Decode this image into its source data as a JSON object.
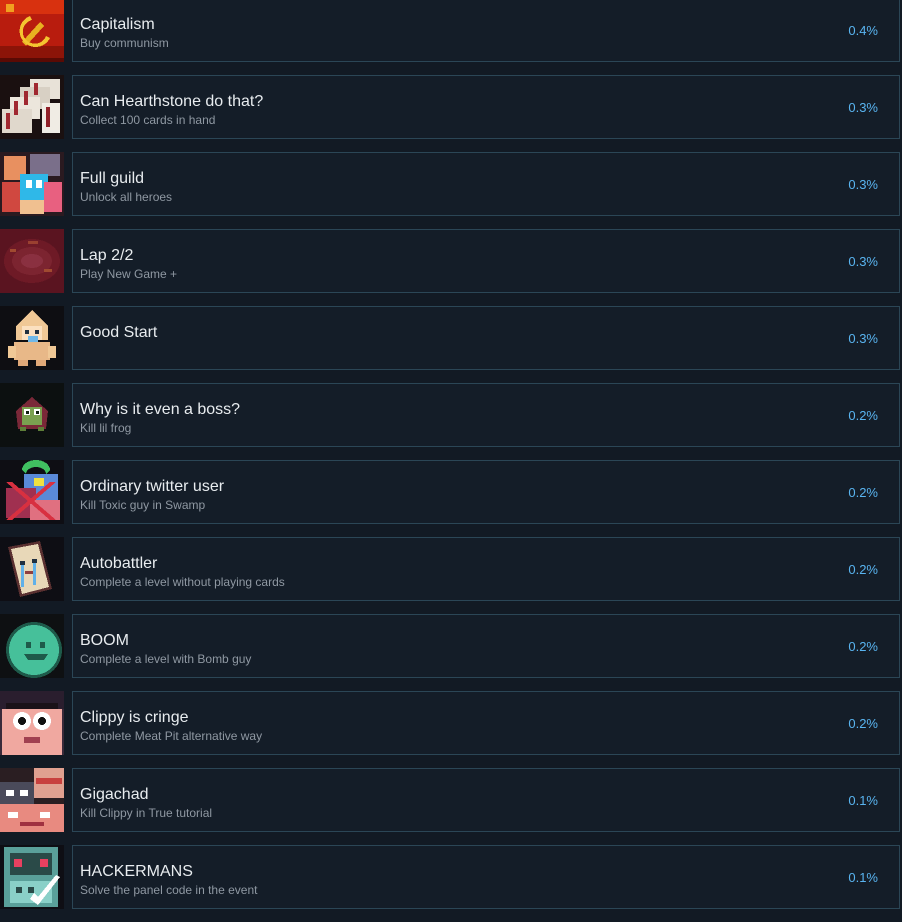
{
  "achievements": [
    {
      "title": "Capitalism",
      "desc": "Buy communism",
      "pct": "0.4%",
      "icon": "hammer-sickle-flag-icon"
    },
    {
      "title": "Can Hearthstone do that?",
      "desc": "Collect 100 cards in hand",
      "pct": "0.3%",
      "icon": "card-stack-icon"
    },
    {
      "title": "Full guild",
      "desc": "Unlock all heroes",
      "pct": "0.3%",
      "icon": "heroes-group-icon"
    },
    {
      "title": "Lap 2/2",
      "desc": "Play New Game +",
      "pct": "0.3%",
      "icon": "swirl-portal-icon"
    },
    {
      "title": "Good Start",
      "desc": "",
      "pct": "0.3%",
      "icon": "baby-hooded-icon"
    },
    {
      "title": "Why is it even a boss?",
      "desc": "Kill lil frog",
      "pct": "0.2%",
      "icon": "frog-icon"
    },
    {
      "title": "Ordinary twitter user",
      "desc": "Kill Toxic guy in Swamp",
      "pct": "0.2%",
      "icon": "crossed-out-monster-icon"
    },
    {
      "title": "Autobattler",
      "desc": "Complete a level without playing cards",
      "pct": "0.2%",
      "icon": "crying-card-icon"
    },
    {
      "title": "BOOM",
      "desc": "Complete a level with Bomb guy",
      "pct": "0.2%",
      "icon": "green-slime-icon"
    },
    {
      "title": "Clippy is cringe",
      "desc": "Complete Meat Pit alternative way",
      "pct": "0.2%",
      "icon": "cringe-face-icon"
    },
    {
      "title": "Gigachad",
      "desc": "Kill Clippy in True tutorial",
      "pct": "0.1%",
      "icon": "gigachad-faces-icon"
    },
    {
      "title": "HACKERMANS",
      "desc": "Solve the panel code in the event",
      "pct": "0.1%",
      "icon": "computer-panel-icon"
    }
  ]
}
